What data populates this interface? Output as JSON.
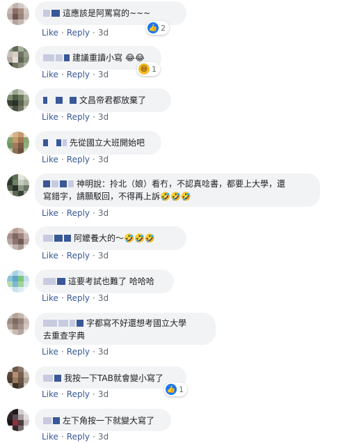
{
  "actions": {
    "like": "Like",
    "reply": "Reply",
    "dot": "·"
  },
  "comments": [
    {
      "text": "這應該是阿罵寫的~~~",
      "emoji": "",
      "time": "3d",
      "reaction_count": "2",
      "reaction_type": "like"
    },
    {
      "text": "建議重讀小寫",
      "emoji": "😂😂",
      "time": "3d",
      "reaction_count": "1",
      "reaction_type": "haha"
    },
    {
      "text": "文昌帝君都放棄了",
      "emoji": "",
      "time": "3d"
    },
    {
      "text": "先從國立大班開始吧",
      "emoji": "",
      "time": "3d"
    },
    {
      "text": "神明說：拎北（娘）看冇，不認真唸書，都要上大學，還",
      "text2": "寫錯字，請願駁回，不得再上訴",
      "emoji": "🤣🤣🤣",
      "time": "3d"
    },
    {
      "text": "阿嬤養大的～",
      "emoji": "🤣🤣🤣",
      "time": "3d"
    },
    {
      "text": "這要考試也難了 哈哈哈",
      "emoji": "",
      "time": "3d"
    },
    {
      "text": "字都寫不好還想考國立大學",
      "text2": "去重查字典",
      "emoji": "",
      "time": "3d"
    },
    {
      "text": "我按一下TAB就會變小寫了",
      "emoji": "",
      "time": "3d",
      "reaction_count": "1",
      "reaction_type": "like"
    },
    {
      "text": "左下角按一下就變大寫了",
      "emoji": "",
      "time": "3d"
    }
  ],
  "colors": {
    "link": "#385898",
    "bubble": "#f2f3f5",
    "like": "#1877f2"
  },
  "icons": {
    "like": "thumbs-up-icon",
    "haha": "laughing-face-icon"
  }
}
